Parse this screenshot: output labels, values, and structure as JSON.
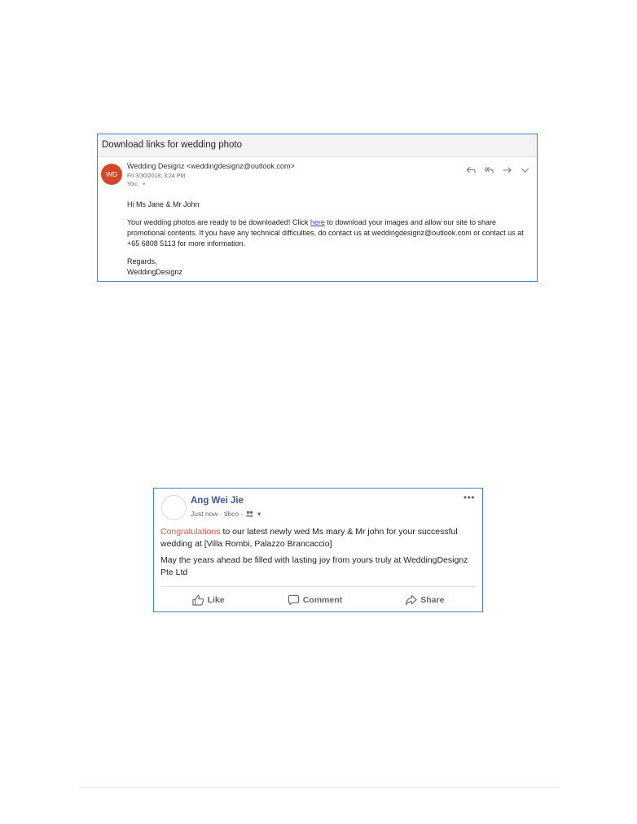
{
  "email": {
    "subject": "Download links for wedding photo",
    "avatar_initials": "WD",
    "avatar_color": "#d24726",
    "sender": "Wedding Designz <weddingdesignz@outlook.com>",
    "date": "Fri 3/30/2018, 3:24 PM",
    "to": "You;",
    "actions": [
      "reply-icon",
      "reply-all-icon",
      "forward-icon",
      "more-options-chevron-icon"
    ],
    "greeting": "Hi Ms Jane & Mr John",
    "body_before_link": "Your wedding photos are ready to be downloaded! Click ",
    "link_text": "here",
    "body_after_link": " to download your images and allow our site to share promotional contents. If you have any technical difficulties, do contact us at weddingdesignz@outlook.com or contact us at +65 6808 5113 for more information.",
    "signoff": "Regards,",
    "signature": "WeddingDesignz"
  },
  "post": {
    "author": "Ang Wei Jie",
    "meta": "Just now · tibco · ",
    "audience_icon": "friends-icon",
    "more_label": "•••",
    "highlight_word": "Congratulations",
    "line1_rest": " to our latest newly wed Ms mary & Mr john for your successful wedding at [Villa Rombi, Palazzo Brancaccio]",
    "line2": "May the years ahead be filled with lasting joy from yours truly at WeddingDesignz Pte Ltd",
    "highlight_color": "#e9574a",
    "actions": {
      "like": "Like",
      "comment": "Comment",
      "share": "Share"
    }
  }
}
